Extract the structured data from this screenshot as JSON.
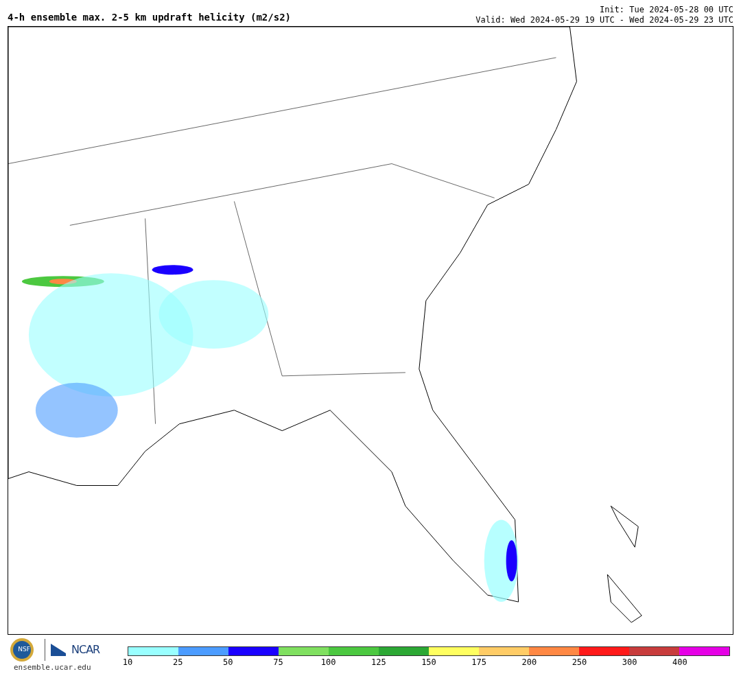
{
  "header": {
    "title": "4-h ensemble max. 2-5 km updraft helicity (m2/s2)",
    "init": "Init: Tue 2024-05-28 00 UTC",
    "valid": "Valid: Wed 2024-05-29 19 UTC - Wed 2024-05-29 23 UTC"
  },
  "footer": {
    "logos": [
      "NSF",
      "NCAR"
    ],
    "url": "ensemble.ucar.edu"
  },
  "colorbar": {
    "segments": [
      {
        "color": "#99ffff",
        "label": "10"
      },
      {
        "color": "#4c9cff",
        "label": "25"
      },
      {
        "color": "#1a00ff",
        "label": "50"
      },
      {
        "color": "#80e060",
        "label": "75"
      },
      {
        "color": "#4cc840",
        "label": "100"
      },
      {
        "color": "#2ca834",
        "label": "125"
      },
      {
        "color": "#ffff60",
        "label": "150"
      },
      {
        "color": "#ffcc66",
        "label": "175"
      },
      {
        "color": "#ff8844",
        "label": "200"
      },
      {
        "color": "#ff1a1a",
        "label": "250"
      },
      {
        "color": "#c83c3c",
        "label": "300"
      },
      {
        "color": "#e600e6",
        "label": "400"
      }
    ]
  }
}
